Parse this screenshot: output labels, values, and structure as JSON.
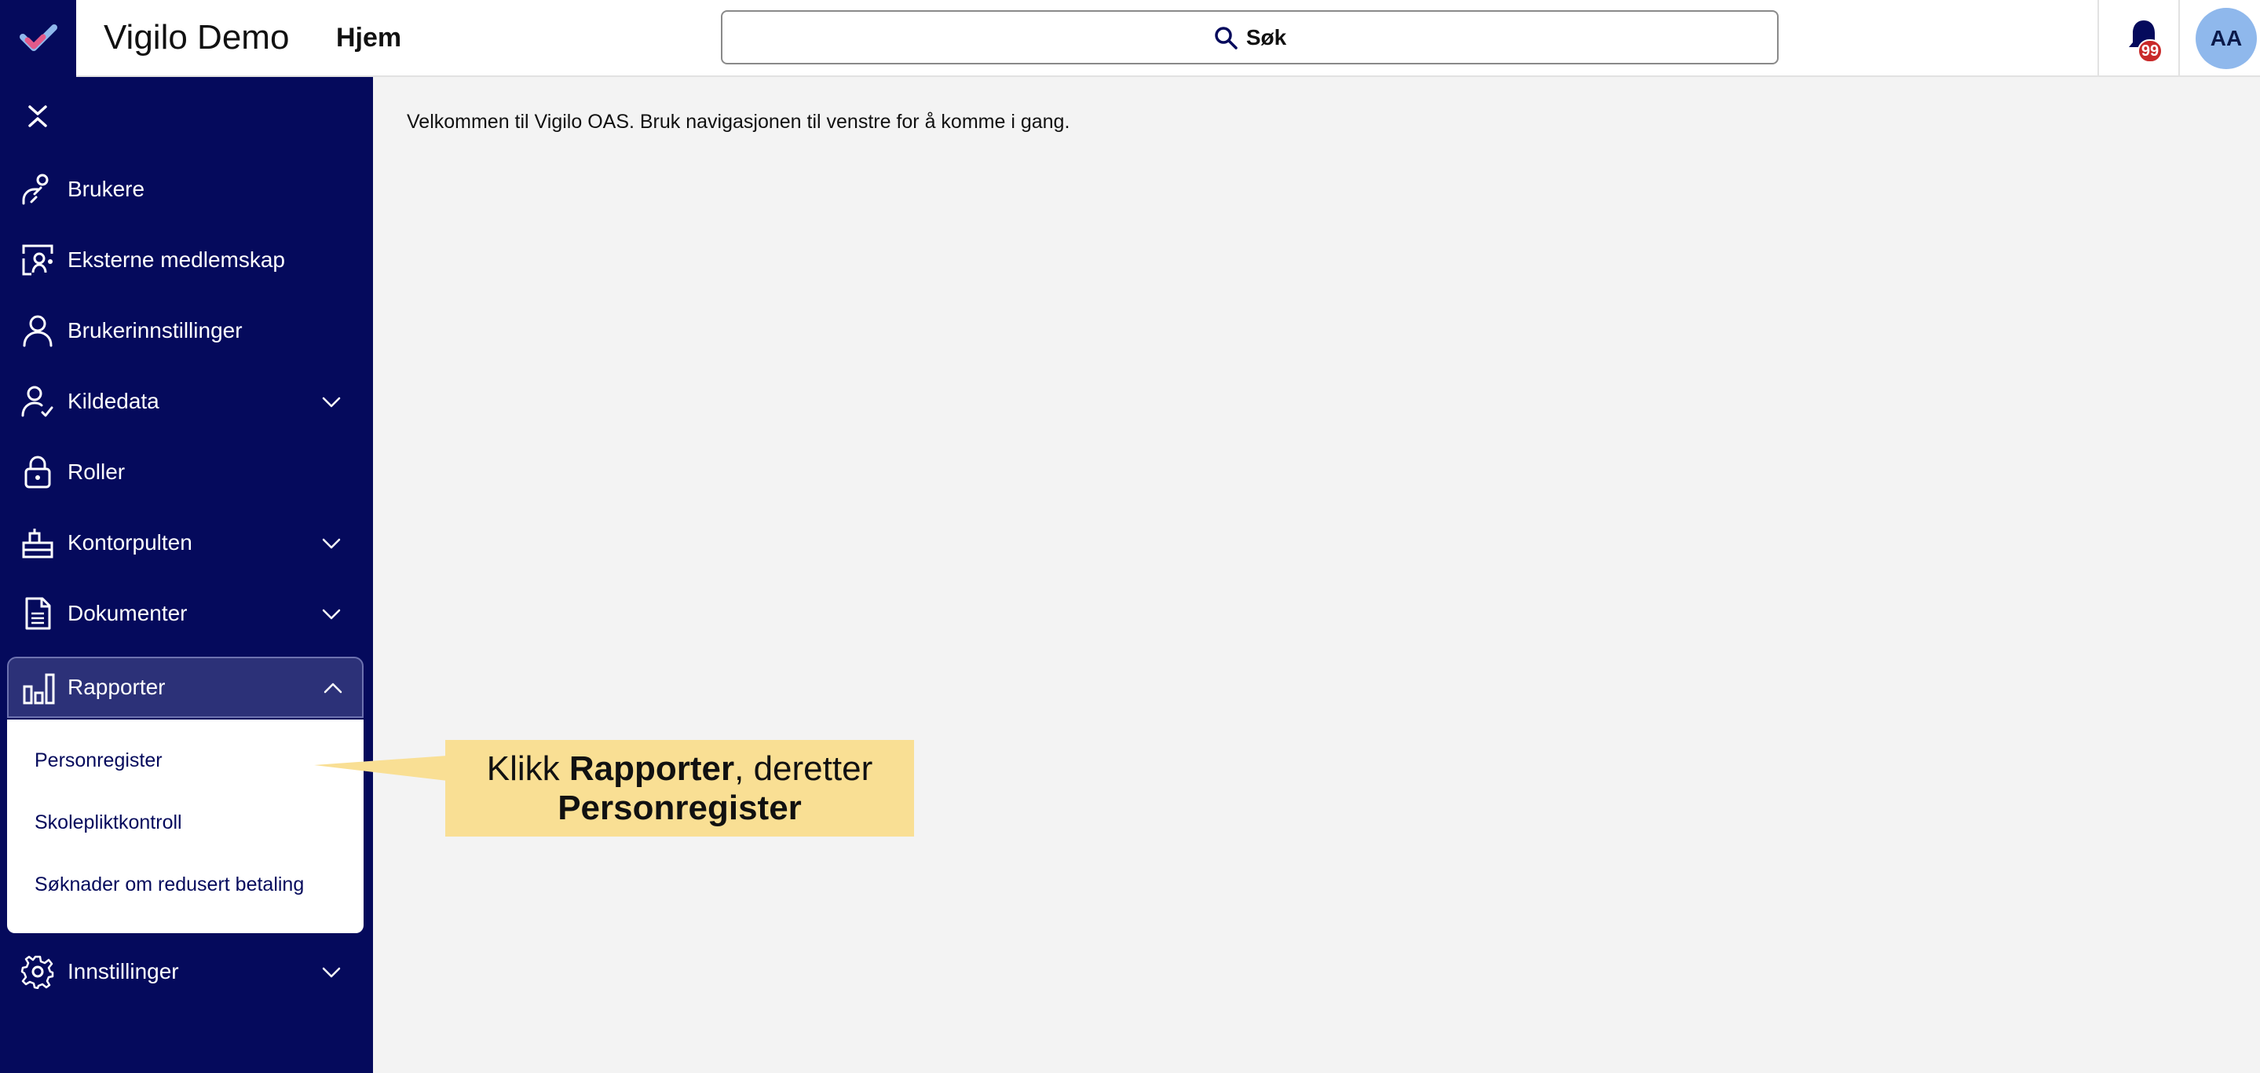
{
  "header": {
    "app_title": "Vigilo Demo",
    "page_title": "Hjem",
    "search_label": "Søk",
    "notification_count": "99",
    "avatar_initials": "AA"
  },
  "sidebar": {
    "items": [
      {
        "label": "Brukere",
        "icon": "users-icon"
      },
      {
        "label": "Eksterne medlemskap",
        "icon": "external-membership-icon"
      },
      {
        "label": "Brukerinnstillinger",
        "icon": "user-icon"
      },
      {
        "label": "Kildedata",
        "icon": "user-check-icon",
        "expandable": true
      },
      {
        "label": "Roller",
        "icon": "lock-icon"
      },
      {
        "label": "Kontorpulten",
        "icon": "desk-icon",
        "expandable": true
      },
      {
        "label": "Dokumenter",
        "icon": "document-icon",
        "expandable": true
      },
      {
        "label": "Rapporter",
        "icon": "bar-chart-icon",
        "expandable": true,
        "expanded": true
      },
      {
        "label": "Innstillinger",
        "icon": "gear-icon",
        "expandable": true
      }
    ],
    "rapporter_submenu": [
      "Personregister",
      "Skolepliktkontroll",
      "Søknader om redusert betaling"
    ]
  },
  "main": {
    "welcome_text": "Velkommen til Vigilo OAS. Bruk navigasjonen til venstre for å komme i gang."
  },
  "callout": {
    "prefix": "Klikk ",
    "bold1": "Rapporter",
    "middle": ", deretter",
    "bold2": "Personregister"
  },
  "colors": {
    "sidebar_bg": "#050a5c",
    "callout_bg": "#f9df94",
    "badge": "#c92a2a",
    "avatar": "#8fb8ec"
  }
}
